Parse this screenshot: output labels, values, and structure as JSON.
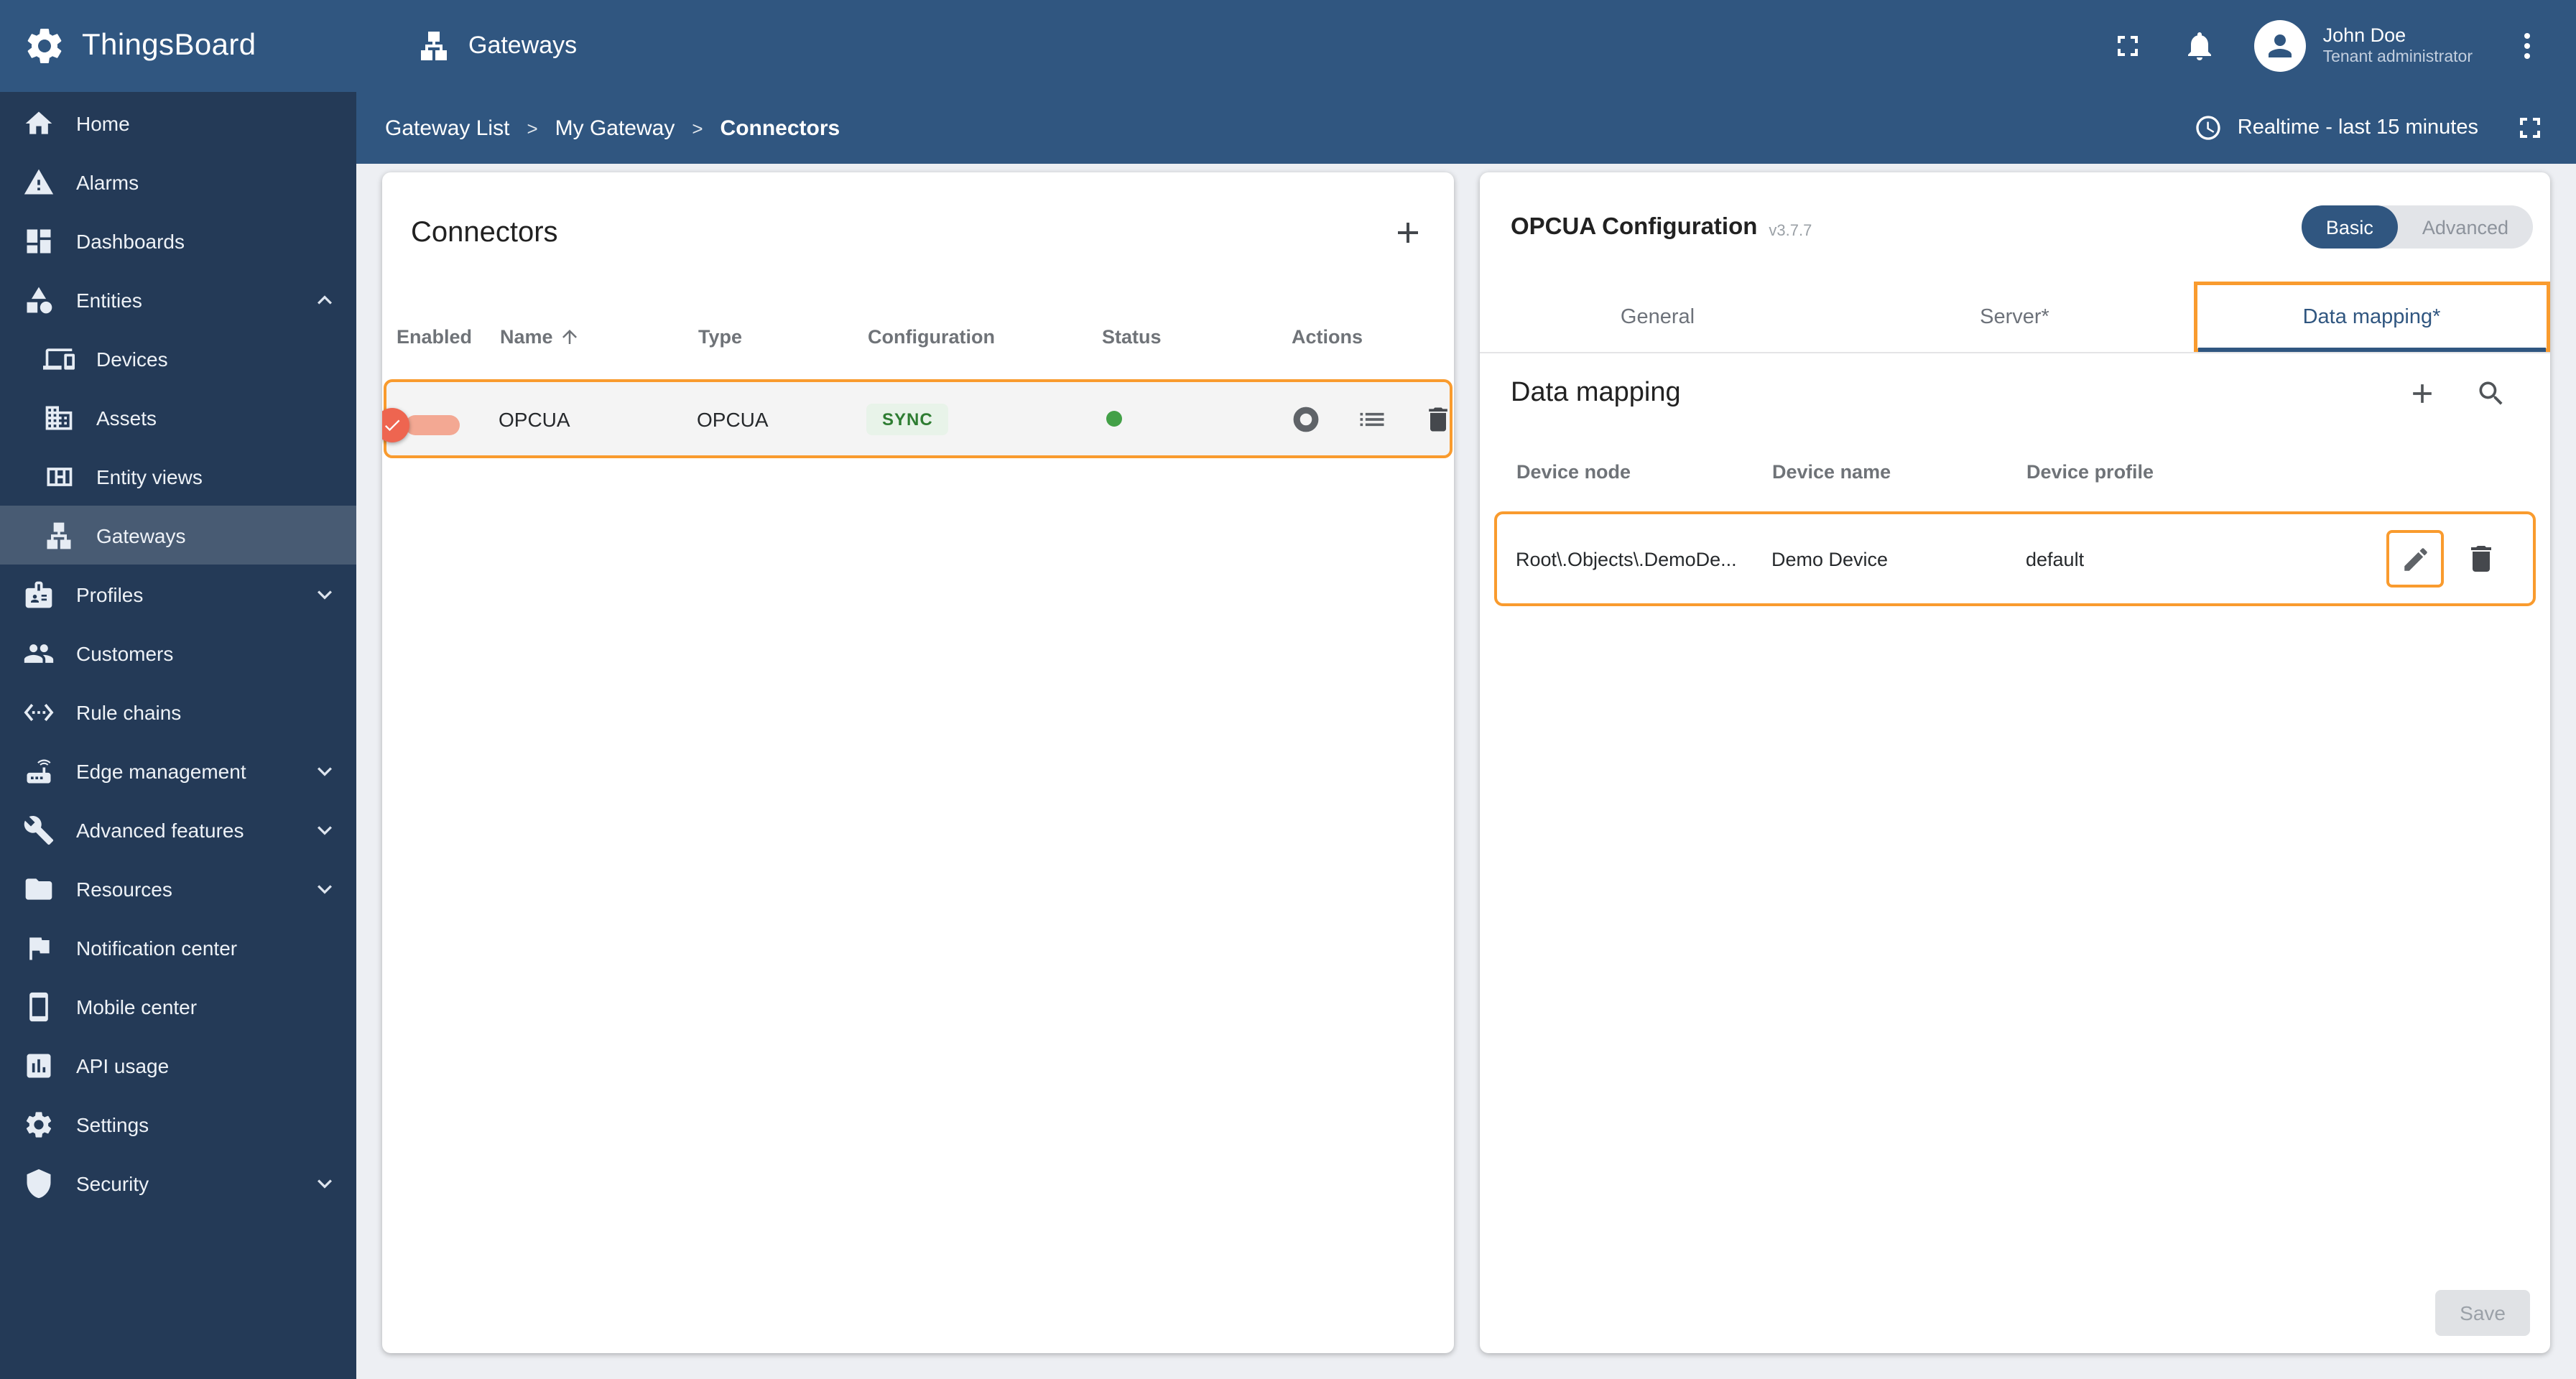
{
  "colors": {
    "header_bg": "#305680",
    "sidebar_bg": "#243a57",
    "accent_highlight": "#f99b2e",
    "toggle_on_knob": "#ee6550",
    "toggle_on_track": "#f3a893",
    "sync_chip_bg": "#e8f3e9",
    "sync_chip_text": "#2e7d32",
    "status_ok_green": "#43a047",
    "active_tab_blue": "#305680",
    "content_bg": "#edeff3"
  },
  "header": {
    "app_name": "ThingsBoard",
    "page_title": "Gateways",
    "user": {
      "name": "John Doe",
      "role": "Tenant administrator"
    }
  },
  "breadcrumb": {
    "items": [
      "Gateway List",
      "My Gateway",
      "Connectors"
    ],
    "separator": ">",
    "realtime_label": "Realtime - last 15 minutes"
  },
  "sidebar": {
    "items": [
      {
        "label": "Home",
        "icon": "home-icon"
      },
      {
        "label": "Alarms",
        "icon": "alarms-icon"
      },
      {
        "label": "Dashboards",
        "icon": "dashboards-icon"
      },
      {
        "label": "Entities",
        "icon": "entities-icon",
        "chevron": "up",
        "expanded": true
      },
      {
        "label": "Devices",
        "icon": "devices-icon",
        "indent": true
      },
      {
        "label": "Assets",
        "icon": "assets-icon",
        "indent": true
      },
      {
        "label": "Entity views",
        "icon": "entity-views-icon",
        "indent": true
      },
      {
        "label": "Gateways",
        "icon": "gateways-icon",
        "indent": true,
        "active": true
      },
      {
        "label": "Profiles",
        "icon": "profiles-icon",
        "chevron": "down"
      },
      {
        "label": "Customers",
        "icon": "customers-icon"
      },
      {
        "label": "Rule chains",
        "icon": "rule-chains-icon"
      },
      {
        "label": "Edge management",
        "icon": "edge-management-icon",
        "chevron": "down"
      },
      {
        "label": "Advanced features",
        "icon": "advanced-features-icon",
        "chevron": "down"
      },
      {
        "label": "Resources",
        "icon": "resources-icon",
        "chevron": "down"
      },
      {
        "label": "Notification center",
        "icon": "notification-center-icon"
      },
      {
        "label": "Mobile center",
        "icon": "mobile-center-icon"
      },
      {
        "label": "API usage",
        "icon": "api-usage-icon"
      },
      {
        "label": "Settings",
        "icon": "settings-icon"
      },
      {
        "label": "Security",
        "icon": "security-icon",
        "chevron": "down"
      }
    ]
  },
  "connectors_panel": {
    "title": "Connectors",
    "columns": [
      "Enabled",
      "Name",
      "Type",
      "Configuration",
      "Status",
      "Actions"
    ],
    "sort_column": "Name",
    "sort_direction": "asc",
    "row": {
      "enabled": true,
      "name": "OPCUA",
      "type": "OPCUA",
      "configuration": "SYNC",
      "status": "connected"
    }
  },
  "config_panel": {
    "title": "OPCUA Configuration",
    "version": "v3.7.7",
    "mode_toggle": {
      "options": [
        "Basic",
        "Advanced"
      ],
      "selected": "Basic"
    },
    "tabs": [
      {
        "label": "General"
      },
      {
        "label": "Server*"
      },
      {
        "label": "Data mapping*",
        "active": true
      }
    ],
    "section_title": "Data mapping",
    "mapping_table": {
      "columns": [
        "Device node",
        "Device name",
        "Device profile"
      ],
      "row": {
        "device_node": "Root\\.Objects\\.DemoDe...",
        "device_name": "Demo Device",
        "device_profile": "default"
      }
    },
    "save_label": "Save"
  }
}
